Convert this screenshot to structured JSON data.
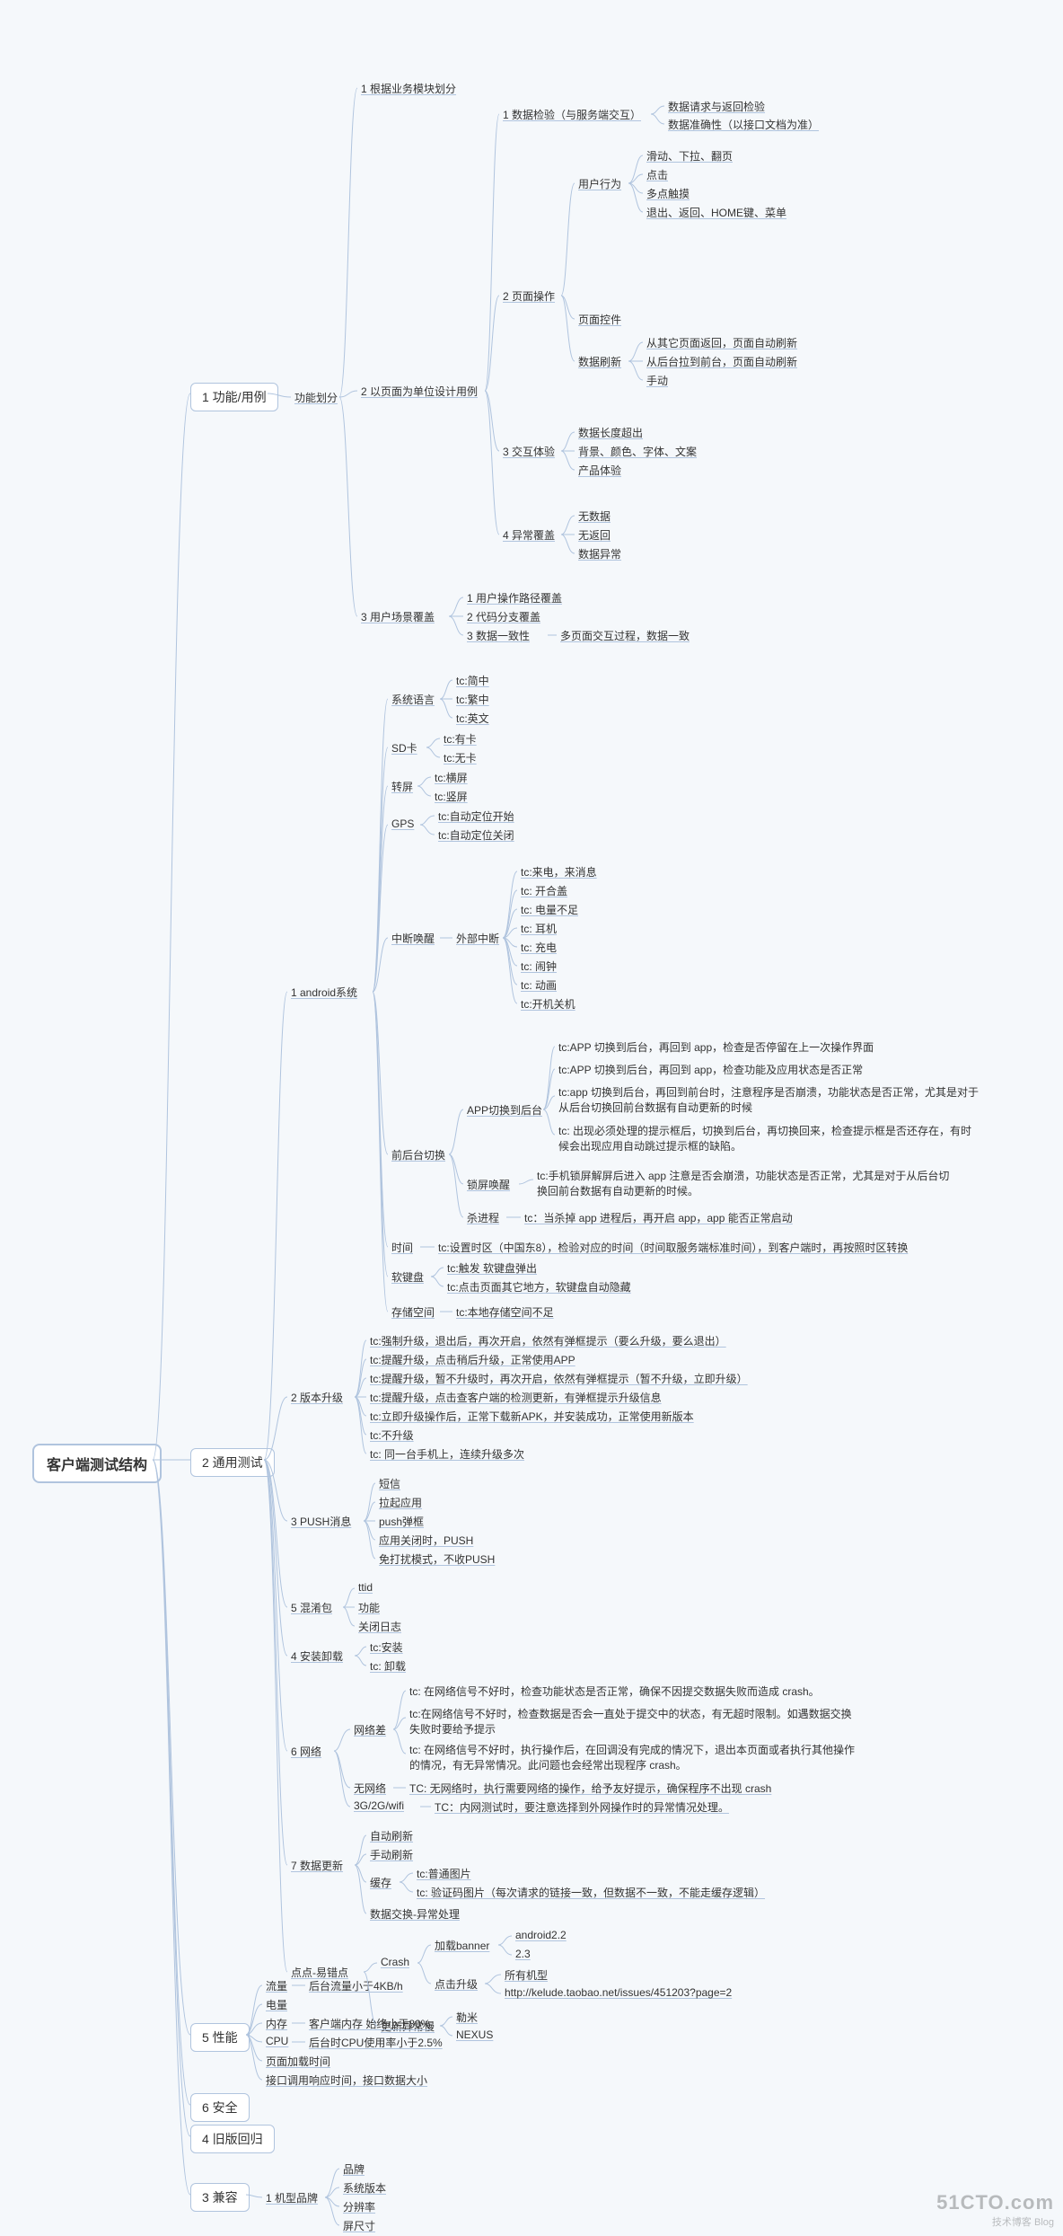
{
  "root": "客户端测试结构",
  "l1": {
    "func": "1 功能/用例",
    "common": "2 通用测试",
    "perf": "5 性能",
    "sec": "6 安全",
    "old": "4 旧版回归",
    "compat": "3 兼容"
  },
  "func": {
    "split": "功能划分",
    "biz": "1 根据业务模块划分",
    "page": "2 以页面为单位设计用例",
    "scene": "3 用户场景覆盖",
    "check": "1 数据检验（与服务端交互）",
    "check1": "数据请求与返回检验",
    "check2": "数据准确性（以接口文档为准）",
    "pageop": "2 页面操作",
    "behave": "用户行为",
    "b1": "滑动、下拉、翻页",
    "b2": "点击",
    "b3": "多点触摸",
    "b4": "退出、返回、HOME键、菜单",
    "widget": "页面控件",
    "refresh": "数据刷新",
    "r1": "从其它页面返回，页面自动刷新",
    "r2": "从后台拉到前台，页面自动刷新",
    "r3": "手动",
    "ux": "3 交互体验",
    "u1": "数据长度超出",
    "u2": "背景、颜色、字体、文案",
    "u3": "产品体验",
    "exc": "4 异常覆盖",
    "e1": "无数据",
    "e2": "无返回",
    "e3": "数据异常",
    "s1": "1 用户操作路径覆盖",
    "s2": "2 代码分支覆盖",
    "s3": "3 数据一致性",
    "s3d": "多页面交互过程，数据一致"
  },
  "android": {
    "title": "1 android系统",
    "lang": "系统语言",
    "lang1": "tc:简中",
    "lang2": "tc:繁中",
    "lang3": "tc:英文",
    "sd": "SD卡",
    "sd1": "tc:有卡",
    "sd2": "tc:无卡",
    "rot": "转屏",
    "rot1": "tc:横屏",
    "rot2": "tc:竖屏",
    "gps": "GPS",
    "gps1": "tc:自动定位开始",
    "gps2": "tc:自动定位关闭",
    "intr": "中断唤醒",
    "ext": "外部中断",
    "i1": "tc:来电，来消息",
    "i2": "tc: 开合盖",
    "i3": "tc: 电量不足",
    "i4": "tc: 耳机",
    "i5": "tc: 充电",
    "i6": "tc: 闹钟",
    "i7": "tc: 动画",
    "i8": "tc:开机关机",
    "fb": "前后台切换",
    "app": "APP切换到后台",
    "a1": "tc:APP 切换到后台，再回到 app，检查是否停留在上一次操作界面",
    "a2": "tc:APP 切换到后台，再回到 app，检查功能及应用状态是否正常",
    "a3": "tc:app 切换到后台，再回到前台时，注意程序是否崩溃，功能状态是否正常，尤其是对于从后台切换回前台数据有自动更新的时候",
    "a4": "tc: 出现必须处理的提示框后，切换到后台，再切换回来，检查提示框是否还存在，有时候会出现应用自动跳过提示框的缺陷。",
    "lock": "锁屏唤醒",
    "l1": "tc:手机锁屏解屏后进入 app 注意是否会崩溃，功能状态是否正常，尤其是对于从后台切换回前台数据有自动更新的时候。",
    "kill": "杀进程",
    "k1": "tc：当杀掉 app 进程后，再开启 app，app 能否正常启动",
    "time": "时间",
    "t1": "tc:设置时区（中国东8），检验对应的时间（时间取服务端标准时间），到客户端时，再按照时区转换",
    "kb": "软键盘",
    "kb1": "tc:触发 软键盘弹出",
    "kb2": "tc:点击页面其它地方，软键盘自动隐藏",
    "store": "存储空间",
    "st1": "tc:本地存储空间不足"
  },
  "ver": {
    "title": "2 版本升级",
    "v1": "tc:强制升级，退出后，再次开启，依然有弹框提示（要么升级，要么退出）",
    "v2": "tc:提醒升级，点击稍后升级，正常使用APP",
    "v3": "tc:提醒升级，暂不升级时，再次开启，依然有弹框提示（暂不升级，立即升级）",
    "v4": "tc:提醒升级，点击查客户端的检测更新，有弹框提示升级信息",
    "v5": "tc:立即升级操作后，正常下载新APK，并安装成功，正常使用新版本",
    "v6": "tc:不升级",
    "v7": "tc: 同一台手机上，连续升级多次"
  },
  "push": {
    "title": "3 PUSH消息",
    "p1": "短信",
    "p2": "拉起应用",
    "p3": "push弹框",
    "p4": "应用关闭时，PUSH",
    "p5": "免打扰模式，不收PUSH"
  },
  "pkg": {
    "title": "5 混淆包",
    "g1": "ttid",
    "g2": "功能",
    "g3": "关闭日志"
  },
  "install": {
    "title": "4 安装卸载",
    "in1": "tc:安装",
    "in2": "tc: 卸载"
  },
  "net": {
    "title": "6 网络",
    "bad": "网络差",
    "b1": "tc: 在网络信号不好时，检查功能状态是否正常，确保不因提交数据失败而造成 crash。",
    "b2": "tc:在网络信号不好时，检查数据是否会一直处于提交中的状态，有无超时限制。如遇数据交换失败时要给予提示",
    "b3": "tc: 在网络信号不好时，执行操作后，在回调没有完成的情况下，退出本页面或者执行其他操作的情况，有无异常情况。此问题也会经常出现程序 crash。",
    "none": "无网络",
    "n1": "TC: 无网络时，执行需要网络的操作，给予友好提示，确保程序不出现 crash",
    "w": "3G/2G/wifi",
    "w1": "TC：内网测试时，要注意选择到外网操作时的异常情况处理。"
  },
  "data": {
    "title": "7 数据更新",
    "d1": "自动刷新",
    "d2": "手动刷新",
    "cache": "缓存",
    "c1": "tc:普通图片",
    "c2": "tc: 验证码图片（每次请求的链接一致，但数据不一致，不能走缓存逻辑）",
    "d3": "数据交换-异常处理"
  },
  "err": {
    "title": "点点-易错点",
    "crash": "Crash",
    "banner": "加载banner",
    "bn1": "android2.2",
    "bn2": "2.3",
    "up": "点击升级",
    "up1": "所有机型",
    "up2": "http://kelude.taobao.net/issues/451203?page=2",
    "slow": "更新异常慢",
    "sl1": "勒米",
    "sl2": "NEXUS"
  },
  "perf": {
    "flow": "流量",
    "flow1": "后台流量小于4KB/h",
    "bat": "电量",
    "mem": "内存",
    "mem1": "客户端内存 始终小于80%",
    "cpu": "CPU",
    "cpu1": "后台时CPU使用率小于2.5%",
    "load": "页面加载时间",
    "api": "接口调用响应时间，接口数据大小"
  },
  "compat": {
    "model": "1 机型品牌",
    "m1": "品牌",
    "m2": "系统版本",
    "m3": "分辨率",
    "m4": "屏尺寸"
  },
  "wm": {
    "big": "51CTO.com",
    "small": "技术博客 Blog"
  }
}
